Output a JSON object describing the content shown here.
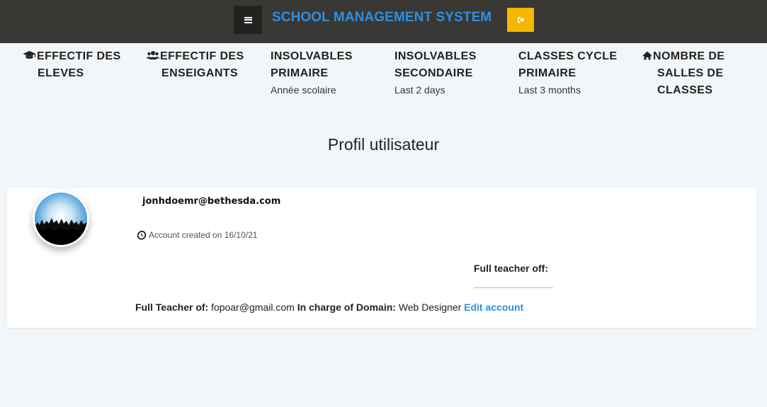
{
  "header": {
    "title": "SCHOOL MANAGEMENT SYSTEM",
    "menu_icon": "bars-icon",
    "logout_icon": "sign-out-icon",
    "title_color": "#2f8fdc",
    "logout_color": "#f5b800"
  },
  "stats": [
    {
      "line1": "EFFECTIF DES",
      "line2": "ELEVES",
      "subtitle": "",
      "icon": "graduation-cap-icon"
    },
    {
      "line1": "EFFECTIF DES",
      "line2": "ENSEIGANTS",
      "subtitle": "",
      "icon": "users-icon"
    },
    {
      "line1": "INSOLVABLES",
      "line2": "PRIMAIRE",
      "subtitle": "Année scolaire"
    },
    {
      "line1": "INSOLVABLES",
      "line2": "SECONDAIRE",
      "subtitle": "Last 2 days"
    },
    {
      "line1": "CLASSES CYCLE",
      "line2": "PRIMAIRE",
      "subtitle": "Last 3 months"
    },
    {
      "line1": "NOMBRE DE",
      "line2": "SALLES DE",
      "line3": "CLASSES",
      "subtitle": "",
      "icon": "home-icon"
    }
  ],
  "page": {
    "title": "Profil utilisateur"
  },
  "profile": {
    "email": "jonhdoemr@bethesda.com",
    "account_created": "Account created on 16/10/21",
    "full_teacher_off_label": "Full teacher off:",
    "full_teacher_of_label": "Full Teacher of:",
    "full_teacher_of_value": "fopoar@gmail.com",
    "domain_label": "In charge of Domain:",
    "domain_value": "Web Designer",
    "edit_label": "Edit account"
  }
}
